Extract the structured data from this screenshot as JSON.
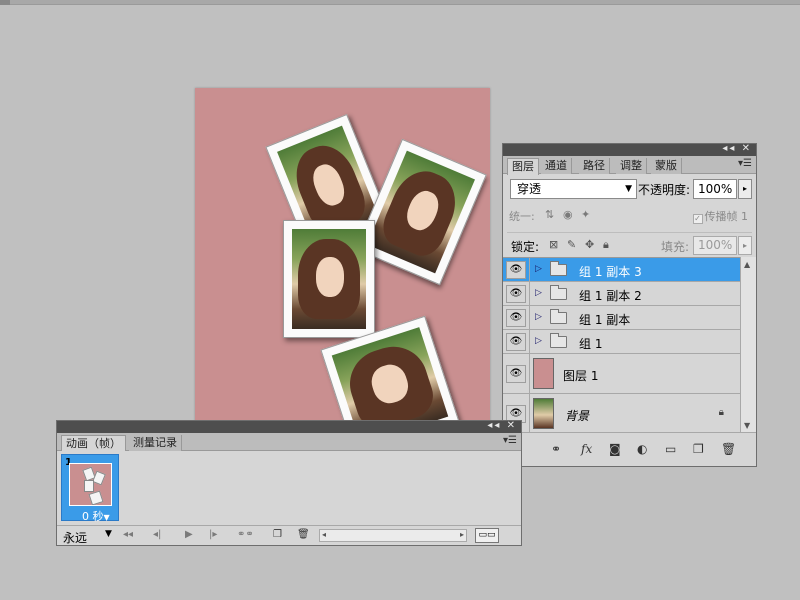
{
  "layers_panel": {
    "tabs": [
      "图层",
      "通道",
      "路径",
      "调整",
      "蒙版"
    ],
    "blend_mode": "穿透",
    "opacity_label": "不透明度:",
    "opacity_value": "100%",
    "unify_label": "统一:",
    "propagate_label": "传播帧 1",
    "lock_label": "锁定:",
    "fill_label": "填充:",
    "fill_value": "100%",
    "layers": [
      {
        "name": "组 1 副本 3",
        "type": "group",
        "selected": true
      },
      {
        "name": "组 1 副本 2",
        "type": "group",
        "selected": false
      },
      {
        "name": "组 1 副本",
        "type": "group",
        "selected": false
      },
      {
        "name": "组 1",
        "type": "group",
        "selected": false
      },
      {
        "name": "图层 1",
        "type": "layer",
        "thumb_color": "#c98f90"
      },
      {
        "name": "背景",
        "type": "background",
        "locked": true
      }
    ]
  },
  "anim_panel": {
    "tabs": [
      "动画（帧）",
      "测量记录"
    ],
    "frame_number": "1",
    "frame_delay": "0 秒",
    "loop": "永远"
  },
  "colors": {
    "canvas_bg": "#c98f90",
    "selection": "#3a9be8",
    "workspace": "#c0c0c0"
  }
}
